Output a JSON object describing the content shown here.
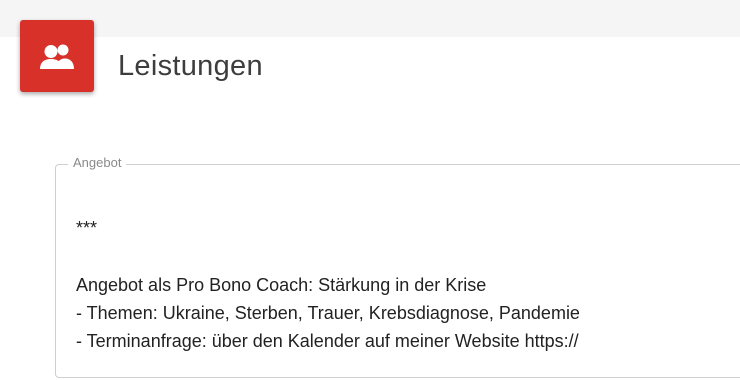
{
  "header": {
    "icon": "people-icon",
    "title": "Leistungen"
  },
  "field": {
    "legend": "Angebot",
    "lines": [
      "***",
      "Angebot als Pro Bono Coach: Stärkung in der Krise",
      "- Themen: Ukraine, Sterben, Trauer, Krebsdiagnose, Pandemie",
      "- Terminanfrage: über den Kalender auf meiner Website https://"
    ]
  },
  "colors": {
    "accent": "#d8312a",
    "top_band": "#f5f5f5",
    "text": "#222222",
    "title": "#3d3d3d",
    "legend": "#8a8a8a"
  }
}
